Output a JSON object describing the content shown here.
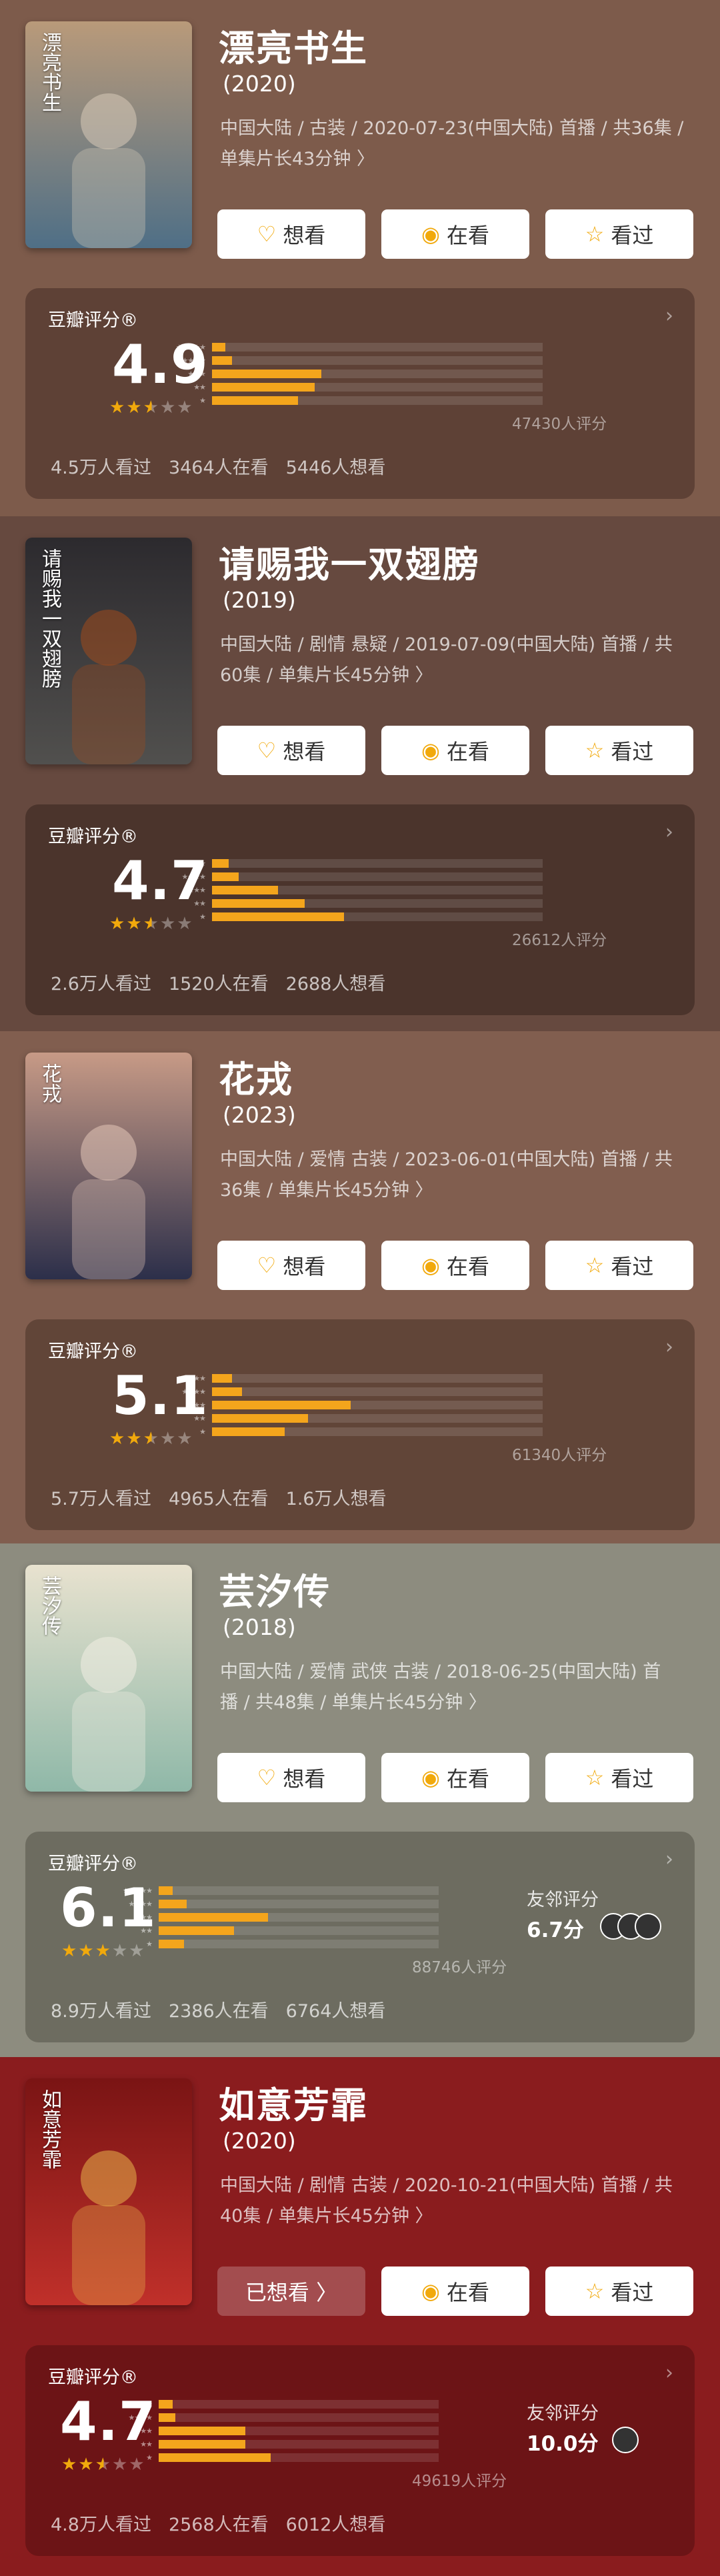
{
  "dramas": [
    {
      "title": "漂亮书生",
      "year": "(2020)",
      "meta": [
        "中国大陆 / 古装 / 2020-07-23(中国大陆) 首播 / 共36集 /",
        "单集片长43分钟 〉"
      ],
      "buttons": {
        "want": "想看",
        "watching": "在看",
        "watched": "看过"
      },
      "rating_label": "豆瓣评分®",
      "score": "4.9",
      "stars": [
        1,
        1,
        0.5,
        0,
        0
      ],
      "dist": [
        0.04,
        0.06,
        0.33,
        0.31,
        0.26
      ],
      "count": "47430人评分",
      "stats": [
        "4.5万人看过",
        "3464人在看",
        "5446人想看"
      ],
      "poster_text": "漂亮书生",
      "bg": "#7d5b4b",
      "panel": "#5e4136"
    },
    {
      "title": "请赐我一双翅膀",
      "year": "(2019)",
      "meta": [
        "中国大陆 / 剧情 悬疑 / 2019-07-09(中国大陆) 首播 / 共",
        "60集 / 单集片长45分钟 〉"
      ],
      "buttons": {
        "want": "想看",
        "watching": "在看",
        "watched": "看过"
      },
      "rating_label": "豆瓣评分®",
      "score": "4.7",
      "stars": [
        1,
        1,
        0.5,
        0,
        0
      ],
      "dist": [
        0.05,
        0.08,
        0.2,
        0.28,
        0.4
      ],
      "count": "26612人评分",
      "stats": [
        "2.6万人看过",
        "1520人在看",
        "2688人想看"
      ],
      "poster_text": "请赐我一双翅膀",
      "bg": "#66493f",
      "panel": "#4b342c"
    },
    {
      "title": "花戎",
      "year": "(2023)",
      "meta": [
        "中国大陆 / 爱情 古装 / 2023-06-01(中国大陆) 首播 / 共",
        "36集 / 单集片长45分钟 〉"
      ],
      "buttons": {
        "want": "想看",
        "watching": "在看",
        "watched": "看过"
      },
      "rating_label": "豆瓣评分®",
      "score": "5.1",
      "stars": [
        1,
        1,
        0.5,
        0,
        0
      ],
      "dist": [
        0.06,
        0.09,
        0.42,
        0.29,
        0.22
      ],
      "count": "61340人评分",
      "stats": [
        "5.7万人看过",
        "4965人在看",
        "1.6万人想看"
      ],
      "poster_text": "花戎",
      "bg": "#815e4f",
      "panel": "#614538"
    },
    {
      "title": "芸汐传",
      "year": "(2018)",
      "meta": [
        "中国大陆 / 爱情 武侠 古装 / 2018-06-25(中国大陆) 首",
        "播 / 共48集 / 单集片长45分钟 〉"
      ],
      "buttons": {
        "want": "想看",
        "watching": "在看",
        "watched": "看过"
      },
      "rating_label": "豆瓣评分®",
      "score": "6.1",
      "stars": [
        1,
        1,
        1,
        0,
        0
      ],
      "dist": [
        0.05,
        0.1,
        0.39,
        0.27,
        0.09
      ],
      "count": "88746人评分",
      "stats": [
        "8.9万人看过",
        "2386人在看",
        "6764人想看"
      ],
      "friend_label": "友邻评分",
      "friend_score": "6.7分",
      "poster_text": "芸汐传",
      "bg": "#8d8c7f",
      "panel": "#6d6c60"
    },
    {
      "title": "如意芳霏",
      "year": "(2020)",
      "meta": [
        "中国大陆 / 剧情 古装 / 2020-10-21(中国大陆) 首播 / 共",
        "40集 / 单集片长45分钟 〉"
      ],
      "buttons": {
        "want": "已想看 〉",
        "watching": "在看",
        "watched": "看过"
      },
      "rating_label": "豆瓣评分®",
      "score": "4.7",
      "stars": [
        1,
        1,
        0.5,
        0,
        0
      ],
      "dist": [
        0.05,
        0.06,
        0.31,
        0.31,
        0.4
      ],
      "count": "49619人评分",
      "stats": [
        "4.8万人看过",
        "2568人在看",
        "6012人想看"
      ],
      "friend_label": "友邻评分",
      "friend_score": "10.0分",
      "poster_text": "如意芳霏",
      "bg": "#8a1c1e",
      "panel": "#6c1416"
    }
  ]
}
